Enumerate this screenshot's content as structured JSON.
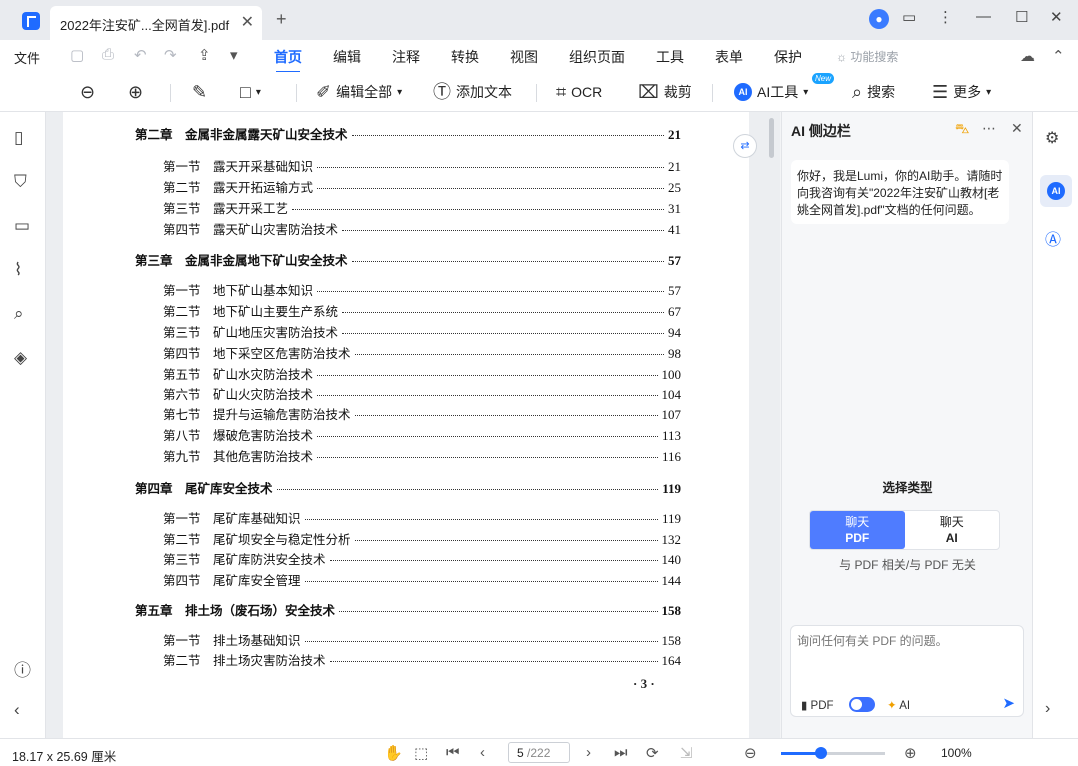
{
  "titlebar": {
    "tab_title": "2022年注安矿...全网首发].pdf",
    "close_glyph": "✕",
    "new_tab_glyph": "+",
    "user_glyph": "👤"
  },
  "menubar": {
    "file_label": "文件",
    "tabs": [
      "首页",
      "编辑",
      "注释",
      "转换",
      "视图",
      "组织页面",
      "工具",
      "表单",
      "保护"
    ],
    "active_tab": "首页",
    "feature_search": "功能搜索"
  },
  "toolbar": {
    "edit_all": "编辑全部",
    "add_text": "添加文本",
    "ocr": "OCR",
    "crop": "裁剪",
    "ai_tools": "AI工具",
    "new_badge": "New",
    "search": "搜索",
    "more": "更多"
  },
  "toc": [
    {
      "type": "ch",
      "label": "第二章　金属非金属露天矿山安全技术",
      "page": "21"
    },
    {
      "type": "sec",
      "label": "第一节　露天开采基础知识",
      "page": "21"
    },
    {
      "type": "sec",
      "label": "第二节　露天开拓运输方式",
      "page": "25"
    },
    {
      "type": "sec",
      "label": "第三节　露天开采工艺",
      "page": "31"
    },
    {
      "type": "sec",
      "label": "第四节　露天矿山灾害防治技术",
      "page": "41"
    },
    {
      "type": "ch",
      "label": "第三章　金属非金属地下矿山安全技术",
      "page": "57"
    },
    {
      "type": "sec",
      "label": "第一节　地下矿山基本知识",
      "page": "57"
    },
    {
      "type": "sec",
      "label": "第二节　地下矿山主要生产系统",
      "page": "67"
    },
    {
      "type": "sec",
      "label": "第三节　矿山地压灾害防治技术",
      "page": "94"
    },
    {
      "type": "sec",
      "label": "第四节　地下采空区危害防治技术",
      "page": "98"
    },
    {
      "type": "sec",
      "label": "第五节　矿山水灾防治技术",
      "page": "100"
    },
    {
      "type": "sec",
      "label": "第六节　矿山火灾防治技术",
      "page": "104"
    },
    {
      "type": "sec",
      "label": "第七节　提升与运输危害防治技术",
      "page": "107"
    },
    {
      "type": "sec",
      "label": "第八节　爆破危害防治技术",
      "page": "113"
    },
    {
      "type": "sec",
      "label": "第九节　其他危害防治技术",
      "page": "116"
    },
    {
      "type": "ch",
      "label": "第四章　尾矿库安全技术",
      "page": "119"
    },
    {
      "type": "sec",
      "label": "第一节　尾矿库基础知识",
      "page": "119"
    },
    {
      "type": "sec",
      "label": "第二节　尾矿坝安全与稳定性分析",
      "page": "132"
    },
    {
      "type": "sec",
      "label": "第三节　尾矿库防洪安全技术",
      "page": "140"
    },
    {
      "type": "sec",
      "label": "第四节　尾矿库安全管理",
      "page": "144"
    },
    {
      "type": "ch",
      "label": "第五章　排土场（废石场）安全技术",
      "page": "158"
    },
    {
      "type": "sec",
      "label": "第一节　排土场基础知识",
      "page": "158"
    },
    {
      "type": "sec",
      "label": "第二节　排土场灾害防治技术",
      "page": "164"
    }
  ],
  "page_footer": "· 3 ·",
  "ai_panel": {
    "title": "AI 侧边栏",
    "greeting": "你好，我是Lumi，你的AI助手。请随时向我咨询有关\"2022年注安矿山教材[老姚全网首发].pdf\"文档的任何问题。",
    "choose_type": "选择类型",
    "opt_pdf_line1": "聊天",
    "opt_pdf_line2": "PDF",
    "opt_ai_line1": "聊天",
    "opt_ai_line2": "AI",
    "sub_text": "与 PDF 相关/与 PDF 无关",
    "input_placeholder": "询问任何有关 PDF 的问题。",
    "pdf_label": "PDF",
    "ai_label": "AI"
  },
  "statusbar": {
    "dimensions": "18.17 x 25.69 厘米",
    "current_page": "5",
    "total_pages": "/222",
    "zoom_level": 0.38,
    "zoom": "100%"
  },
  "colors": {
    "accent": "#1f6bff"
  }
}
